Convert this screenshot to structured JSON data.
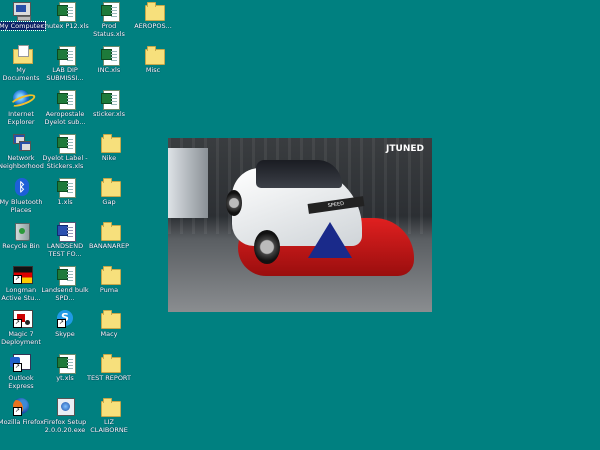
{
  "desktop": {
    "background_color": "#008080",
    "icons": [
      {
        "label": "My Computer",
        "icon": "computer-icon"
      },
      {
        "label": "chutex P12.xls",
        "icon": "excel-file-icon"
      },
      {
        "label": "Prod Status.xls",
        "icon": "excel-file-icon"
      },
      {
        "label": "AEROPOS...",
        "icon": "folder-icon"
      },
      {
        "label": "My Documents",
        "icon": "my-documents-icon"
      },
      {
        "label": "LAB DIP SUBMISSI...",
        "icon": "excel-file-icon"
      },
      {
        "label": "INC.xls",
        "icon": "excel-file-icon"
      },
      {
        "label": "Misc",
        "icon": "folder-icon"
      },
      {
        "label": "Internet Explorer",
        "icon": "internet-explorer-icon"
      },
      {
        "label": "Aeropostale Dyelot sub...",
        "icon": "excel-file-icon"
      },
      {
        "label": "sticker.xls",
        "icon": "excel-file-icon"
      },
      {
        "label": "Network Neighborhood",
        "icon": "network-neighborhood-icon"
      },
      {
        "label": "Dyelot Label - Stickers.xls",
        "icon": "excel-file-icon"
      },
      {
        "label": "Nike",
        "icon": "folder-icon"
      },
      {
        "label": "My Bluetooth Places",
        "icon": "bluetooth-icon"
      },
      {
        "label": "1.xls",
        "icon": "excel-file-icon"
      },
      {
        "label": "Gap",
        "icon": "folder-icon"
      },
      {
        "label": "Recycle Bin",
        "icon": "recycle-bin-icon"
      },
      {
        "label": "LANDSEND TEST FO...",
        "icon": "word-file-icon"
      },
      {
        "label": "BANANAREP",
        "icon": "folder-icon"
      },
      {
        "label": "Longman Active Stu...",
        "icon": "longman-app-icon"
      },
      {
        "label": "Landsend bulk SPD...",
        "icon": "excel-file-icon"
      },
      {
        "label": "Puma",
        "icon": "folder-icon"
      },
      {
        "label": "Magic 7 Deployment",
        "icon": "magic-app-icon"
      },
      {
        "label": "Skype",
        "icon": "skype-icon"
      },
      {
        "label": "Macy",
        "icon": "folder-icon"
      },
      {
        "label": "Outlook Express",
        "icon": "outlook-express-icon"
      },
      {
        "label": "yt.xls",
        "icon": "excel-file-icon"
      },
      {
        "label": "TEST REPORT",
        "icon": "folder-icon"
      },
      {
        "label": "Mozilla Firefox",
        "icon": "firefox-icon"
      },
      {
        "label": "Firefox Setup 2.0.0.20.exe",
        "icon": "setup-exe-icon"
      },
      {
        "label": "LIZ CLAIBORNE",
        "icon": "folder-icon"
      }
    ]
  },
  "wallpaper": {
    "logo_text": "JTUNED",
    "decal_text": "SPEED"
  }
}
